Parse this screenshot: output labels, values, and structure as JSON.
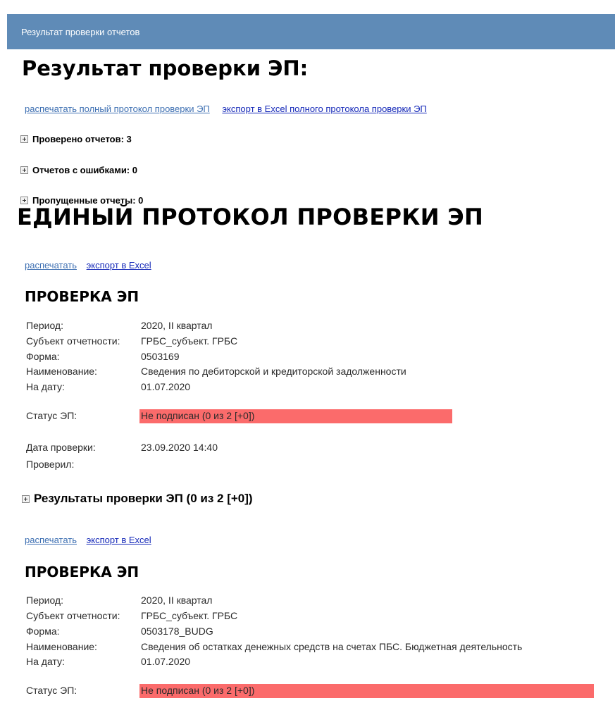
{
  "header": {
    "title": "Результат проверки отчетов"
  },
  "page": {
    "title": "Результат проверки ЭП:"
  },
  "top_links": {
    "print_full": "распечатать полный протокол проверки ЭП",
    "export_full": "экспорт в Excel полного протокола проверки ЭП"
  },
  "summary": {
    "checked": "Проверено отчетов: 3",
    "errors": "Отчетов с ошибками: 0",
    "skipped": "Пропущенные отчеты: 0"
  },
  "protocol": {
    "title": "ЕДИНЫЙ ПРОТОКОЛ ПРОВЕРКИ ЭП"
  },
  "labels": {
    "period": "Период:",
    "subject": "Субъект отчетности:",
    "form": "Форма:",
    "name": "Наименование:",
    "date": "На дату:",
    "status": "Статус ЭП:",
    "check_date": "Дата проверки:",
    "checked_by": "Проверил:"
  },
  "sections": [
    {
      "print_label": "распечатать",
      "export_label": "экспорт в Excel",
      "title": "ПРОВЕРКА ЭП",
      "period": "2020, II квартал",
      "subject": "ГРБС_субъект. ГРБС",
      "form": "0503169",
      "name": "Сведения по дебиторской и кредиторской задолженности",
      "date": "01.07.2020",
      "status": "Не подписан (0 из 2 [+0])",
      "check_date": "23.09.2020 14:40",
      "checked_by": "",
      "results_label": "Результаты проверки ЭП (0 из 2 [+0])"
    },
    {
      "print_label": "распечатать",
      "export_label": "экспорт в Excel",
      "title": "ПРОВЕРКА ЭП",
      "period": "2020, II квартал",
      "subject": "ГРБС_субъект. ГРБС",
      "form": "0503178_BUDG",
      "name": "Сведения об остатках денежных средств на счетах ПБС. Бюджетная деятельность",
      "date": "01.07.2020",
      "status": "Не подписан (0 из 2 [+0])"
    }
  ],
  "colors": {
    "header_bg": "#5f8bb7",
    "status_error_bg": "#fb6b6b",
    "link": "#3d6fb2",
    "link_bold": "#1428b8"
  }
}
